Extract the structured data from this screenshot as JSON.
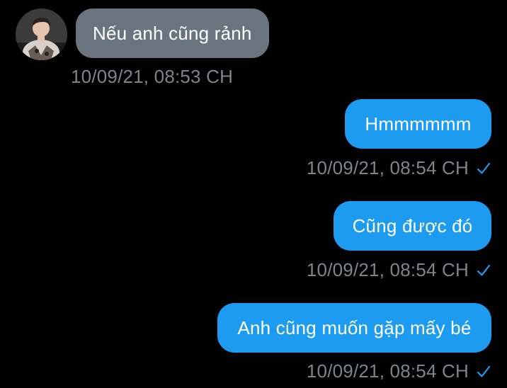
{
  "messages": [
    {
      "direction": "incoming",
      "text": "Nếu anh cũng rảnh",
      "timestamp": "10/09/21, 08:53 CH"
    },
    {
      "direction": "outgoing",
      "text": "Hmmmmmm",
      "timestamp": "10/09/21, 08:54 CH",
      "status_icon": "checkmark-icon"
    },
    {
      "direction": "outgoing",
      "text": "Cũng được đó",
      "timestamp": "10/09/21, 08:54 CH",
      "status_icon": "checkmark-icon"
    },
    {
      "direction": "outgoing",
      "text": "Anh cũng muốn gặp mấy bé",
      "timestamp": "10/09/21, 08:54 CH",
      "status_icon": "checkmark-icon"
    }
  ],
  "colors": {
    "background": "#000000",
    "incoming_bubble": "#6a747e",
    "outgoing_bubble": "#1d9bf0",
    "timestamp": "#7d858c",
    "checkmark": "#1d9bf0"
  }
}
